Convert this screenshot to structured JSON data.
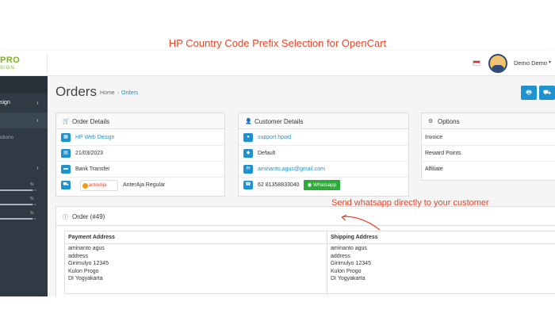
{
  "banner": {
    "title": "HP Country Code Prefix Selection for OpenCart"
  },
  "brand": {
    "logo_main": "PRO",
    "logo_sub": "SIGN"
  },
  "header": {
    "user_name": "Demo Demo",
    "caret": "▾"
  },
  "sidebar": {
    "items": [
      {
        "label": "sign",
        "chevron": "›"
      },
      {
        "label": "",
        "chevron": "›"
      },
      {
        "label": "ctions"
      },
      {
        "label": "",
        "chevron": "›"
      }
    ],
    "bars": [
      {
        "pct_label": "%",
        "value": 0.9
      },
      {
        "pct_label": "%",
        "value": 0.9
      },
      {
        "pct_label": "%",
        "value": 0.9
      }
    ]
  },
  "page": {
    "title": "Orders",
    "breadcrumb": {
      "home": "Home",
      "sep": "›",
      "current": "Orders"
    },
    "buttons": [
      "🖶",
      "⛟"
    ]
  },
  "order_details": {
    "title": "Order Details",
    "store": "HP Web Design",
    "date": "21/03/2023",
    "payment": "Bank Transfer",
    "shipping_logo": "anterAja",
    "shipping": "AnterAja Regular"
  },
  "customer_details": {
    "title": "Customer Details",
    "name": "support hpwd",
    "group": "Default",
    "email": "aminanto.agus@gmail.com",
    "phone": "62 81358833040",
    "whatsapp_label": "Whatsapp"
  },
  "options": {
    "title": "Options",
    "rows": [
      "Invoice",
      "Reward Points",
      "Affiliate"
    ]
  },
  "annotation": "Send whatsapp directly to your customer",
  "order": {
    "title": "Order (#49)",
    "payment_header": "Payment Address",
    "shipping_header": "Shipping Address",
    "payment_lines": [
      "aminanto agus",
      "address",
      "Girimulyo 12345",
      "Kulon Progo",
      "DI Yogyakarta"
    ],
    "shipping_lines": [
      "aminanto agus",
      "address",
      "Girimulyo 12345",
      "Kulon Progo",
      "DI Yogyakarta"
    ]
  },
  "colors": {
    "accent": "#1e91cf",
    "annotation": "#e8462a",
    "whatsapp": "#2eaa3a",
    "sidebar": "#2f3a45"
  }
}
